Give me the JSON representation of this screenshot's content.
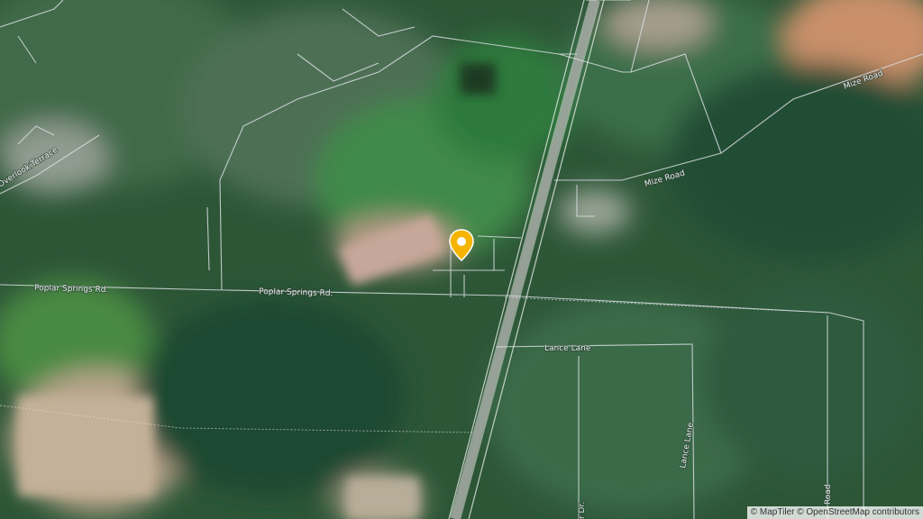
{
  "map": {
    "roads": {
      "poplar_springs_west": "Poplar Springs Rd.",
      "poplar_springs_center": "Poplar Springs Rd.",
      "overlook_terrace": "Overlook Terrace",
      "mize_road_ne": "Mize Road",
      "mize_road": "Mize Road",
      "lance_lane": "Lance Lane",
      "lance_lane_vertical": "Lance Lane",
      "partial_dr": "r Dr.",
      "partial_road": "Road"
    },
    "marker": {
      "color": "#f5b400",
      "icon": "map-pin-icon"
    },
    "attribution": {
      "maptiler": "© MapTiler",
      "osm": "© OpenStreetMap contributors"
    }
  }
}
